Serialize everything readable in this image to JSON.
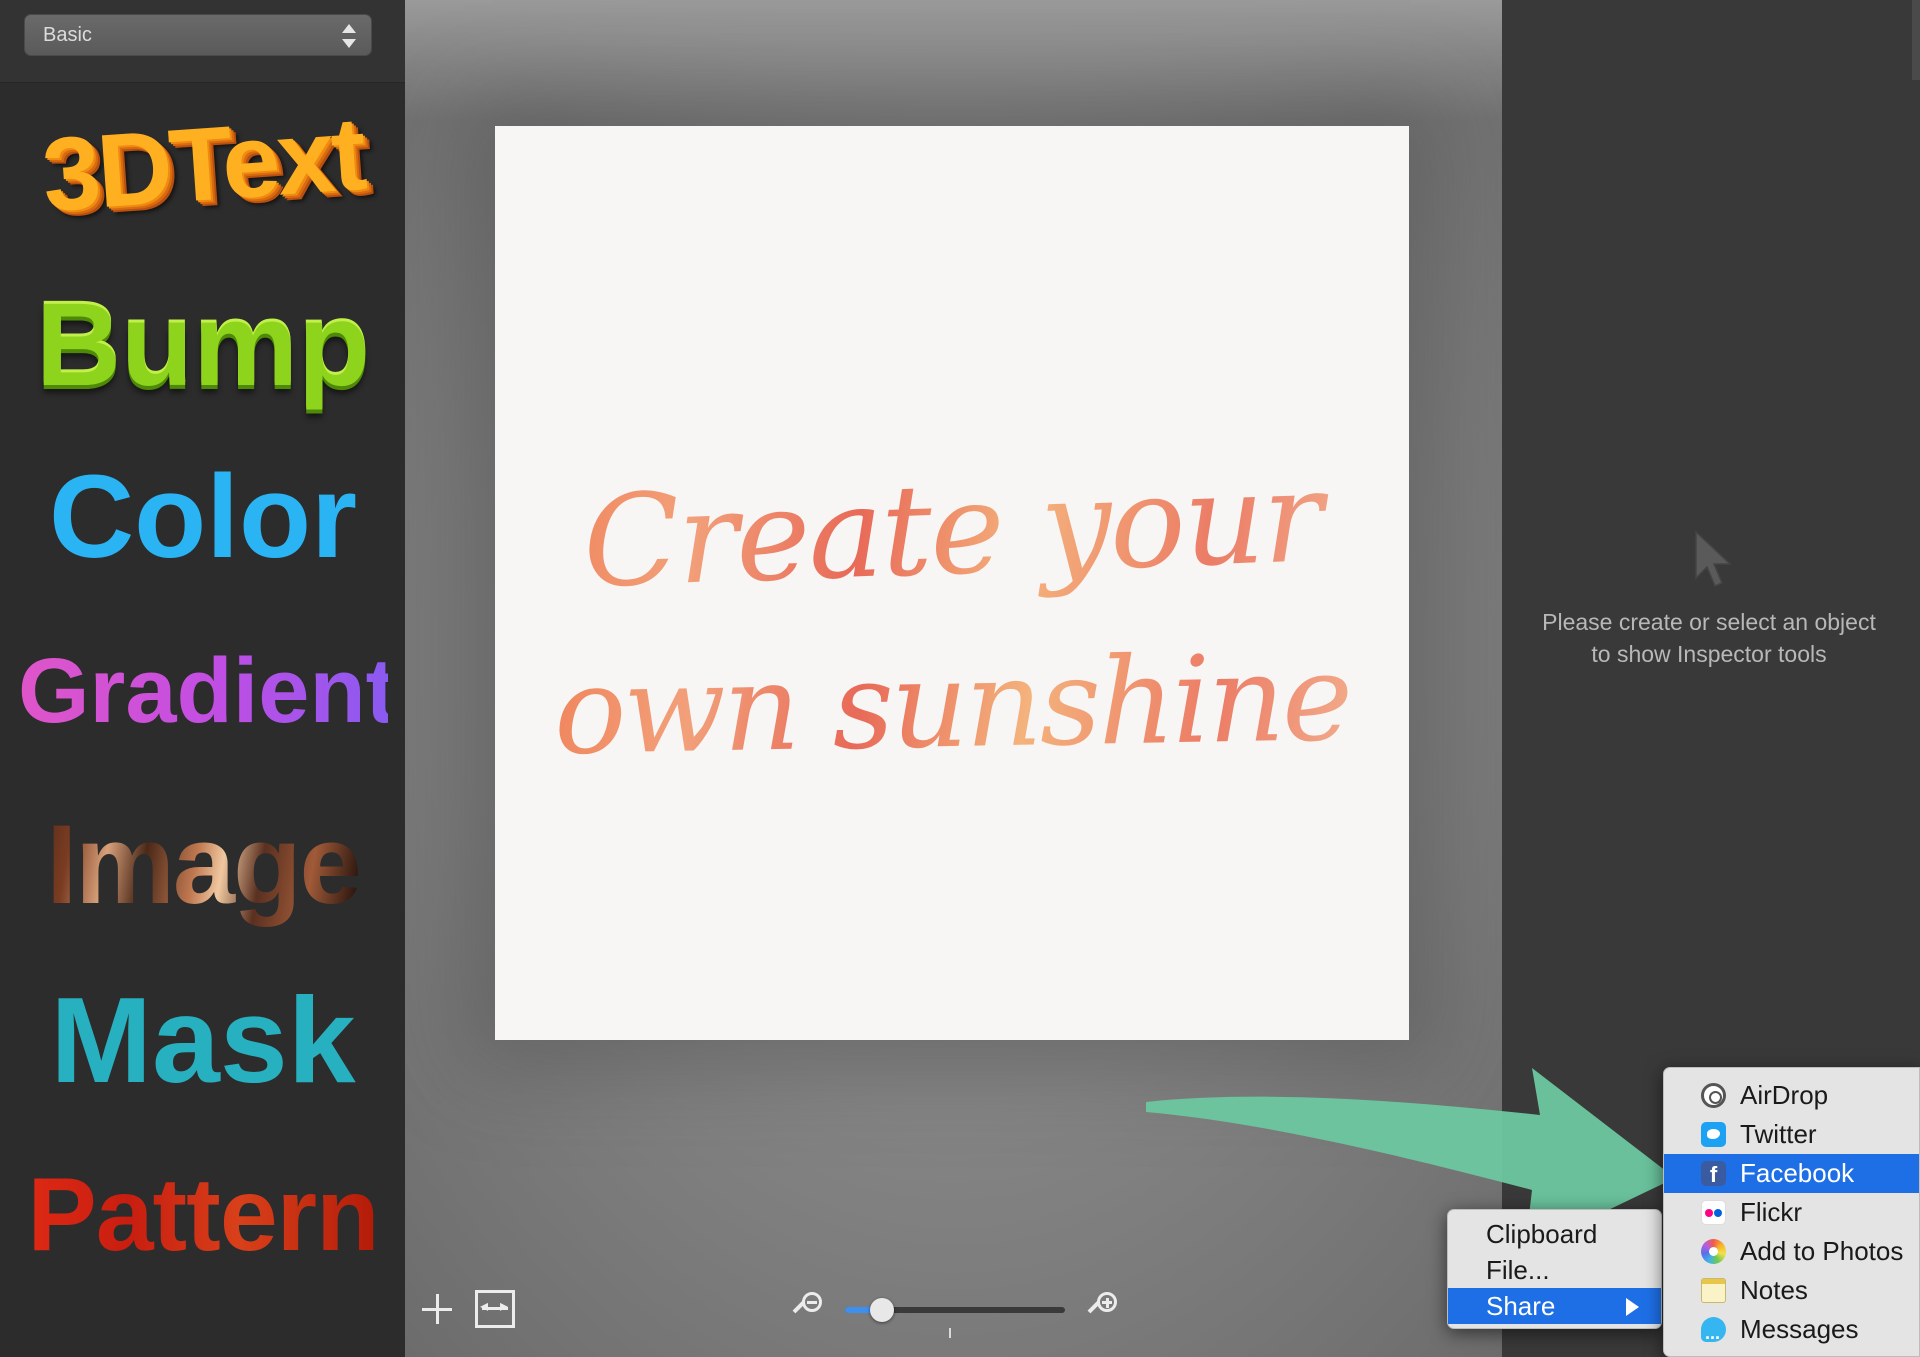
{
  "sidebar": {
    "style_preset": "Basic",
    "styles": [
      "3DText",
      "Bump",
      "Color",
      "Gradient",
      "Image",
      "Mask",
      "Pattern"
    ]
  },
  "canvas": {
    "artwork_text_line1": "Create your",
    "artwork_text_line2": "own sunshine",
    "zoom_level": 0.17
  },
  "inspector": {
    "message": "Please create or select an object to show Inspector tools"
  },
  "export_menu": {
    "items": [
      "Clipboard",
      "File...",
      "Share"
    ],
    "selected": "Share"
  },
  "share_menu": {
    "items": [
      {
        "label": "AirDrop",
        "icon": "airdrop-icon"
      },
      {
        "label": "Twitter",
        "icon": "twitter-icon"
      },
      {
        "label": "Facebook",
        "icon": "facebook-icon"
      },
      {
        "label": "Flickr",
        "icon": "flickr-icon"
      },
      {
        "label": "Add to Photos",
        "icon": "photos-icon"
      },
      {
        "label": "Notes",
        "icon": "notes-icon"
      },
      {
        "label": "Messages",
        "icon": "messages-icon"
      }
    ],
    "selected": "Facebook"
  },
  "colors": {
    "accent": "#1e6fe6",
    "annotation_arrow": "#6cc7a0"
  }
}
